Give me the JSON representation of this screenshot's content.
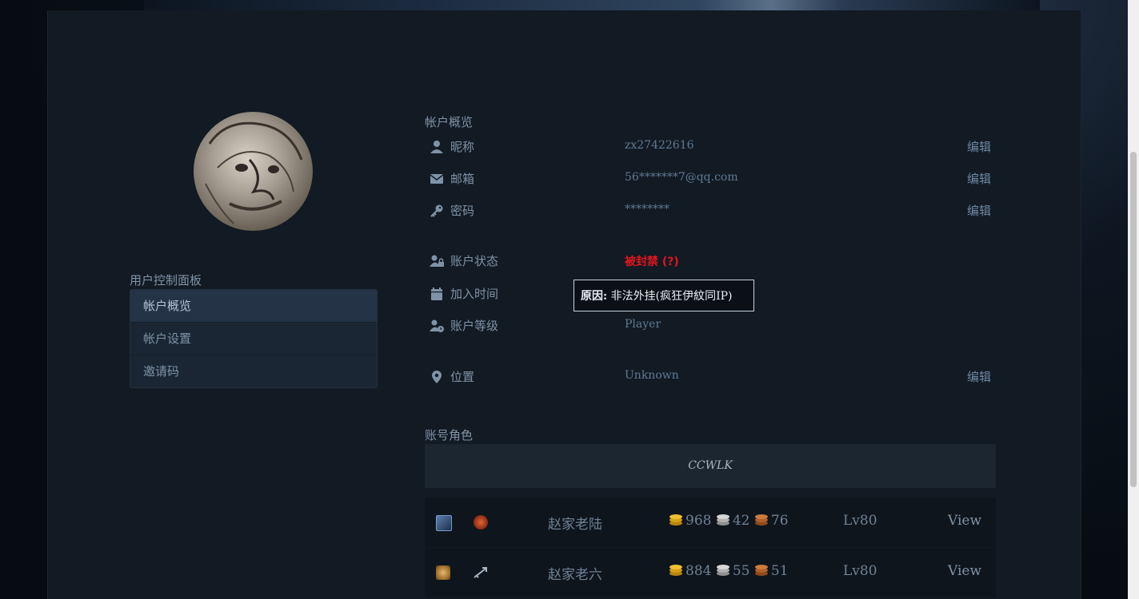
{
  "sidebar": {
    "title": "用户控制面板",
    "items": [
      {
        "label": "帐户概览"
      },
      {
        "label": "帐户设置"
      },
      {
        "label": "邀请码"
      }
    ]
  },
  "overview": {
    "title": "帐户概览",
    "rows": [
      {
        "icon": "user-icon",
        "label": "昵称",
        "value": "zx27422616",
        "edit": "编辑"
      },
      {
        "icon": "envelope-icon",
        "label": "邮箱",
        "value": "56*******7@qq.com",
        "edit": "编辑"
      },
      {
        "icon": "key-icon",
        "label": "密码",
        "value": "********",
        "edit": "编辑"
      },
      {
        "icon": "user-lock-icon",
        "label": "账户状态",
        "value": "被封禁 (?)"
      },
      {
        "icon": "calendar-icon",
        "label": "加入时间",
        "value": ""
      },
      {
        "icon": "user-clock-icon",
        "label": "账户等级",
        "value": "Player"
      },
      {
        "icon": "location-pin-icon",
        "label": "位置",
        "value": "Unknown",
        "edit": "编辑"
      }
    ],
    "tooltip": {
      "prefix": "原因:",
      "text": " 非法外挂(疯狂伊紋同IP)"
    }
  },
  "characters": {
    "title": "账号角色",
    "realm": "CCWLK",
    "rows": [
      {
        "name": "赵家老陆",
        "gold": "968",
        "silver": "42",
        "copper": "76",
        "level": "Lv80",
        "view": "View",
        "race_icon": "draenei-icon",
        "class_icon": "shaman-icon"
      },
      {
        "name": "赵家老六",
        "gold": "884",
        "silver": "55",
        "copper": "51",
        "level": "Lv80",
        "view": "View",
        "race_icon": "human-icon",
        "class_icon": "hunter-icon"
      }
    ]
  },
  "colors": {
    "banned": "#e0161d",
    "gold": "#d4a017",
    "silver": "#c0c0c0",
    "copper": "#c87533"
  }
}
